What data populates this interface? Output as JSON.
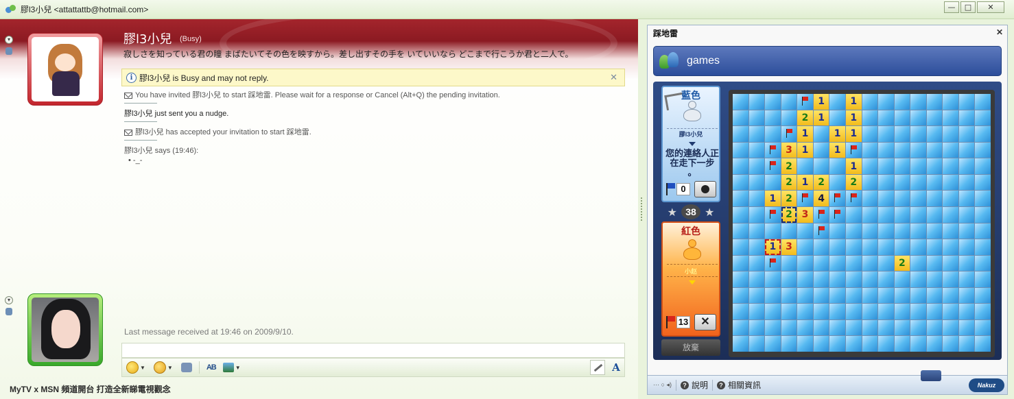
{
  "window": {
    "title": "膠l3小兒 <attattattb@hotmail.com>",
    "min": "—",
    "max": "□",
    "close": "✕"
  },
  "contact": {
    "name": "膠l3小兒",
    "status": "(Busy)",
    "psm": "寂しさを知っている君の瞳 まばたいてその色を映すから。差し出すその手を いていいなら どこまで行こうか君と二人で。"
  },
  "notice": {
    "icon": "i",
    "text": "膠l3小兒 is Busy and may not reply.",
    "close": "✕"
  },
  "messages": {
    "invite": "You have invited 膠l3小兒 to start 踩地雷. Please wait for a response or Cancel (Alt+Q) the pending invitation.",
    "nudge": "膠l3小兒 just sent you a nudge.",
    "accepted": "膠l3小兒 has accepted your invitation to start 踩地雷.",
    "says": "膠l3小兒 says (19:46):",
    "line": "•   -_-"
  },
  "last_message": "Last message received at 19:46 on 2009/9/10.",
  "toolbar": {
    "dropdown": "▼",
    "spell": "AB",
    "font": "A"
  },
  "ad_text": "MyTV x MSN 頻道開台 打造全新睇電視觀念",
  "side": {
    "expand_up": "▾",
    "expand_down": "▾"
  },
  "game": {
    "panel_title": "踩地雷",
    "panel_close": "✕",
    "header": "games",
    "blue": {
      "team": "藍色",
      "player": "膠l3小兒",
      "turn_text": "您的連絡人正在走下一步 。",
      "score": "0"
    },
    "remaining": "38",
    "star": "★",
    "red": {
      "team": "紅色",
      "player": "小赵",
      "score": "13",
      "x_label": "✕"
    },
    "give_up": "放棄",
    "footer": {
      "small": "··· ○ ◂)",
      "help": "說明",
      "info": "相關資訊",
      "q": "?",
      "brand": "Nakuz"
    },
    "board_rows": [
      "....F1.1........",
      "....21.1........",
      "...F1.11........",
      "..F31.1F........",
      "..F2...1........",
      "...212.2........",
      "..12F4FF........",
      "..F23FF.........",
      ".....F..........",
      "..13............",
      "..F.......2.....",
      "................",
      "................",
      "................",
      "................",
      "................"
    ]
  }
}
